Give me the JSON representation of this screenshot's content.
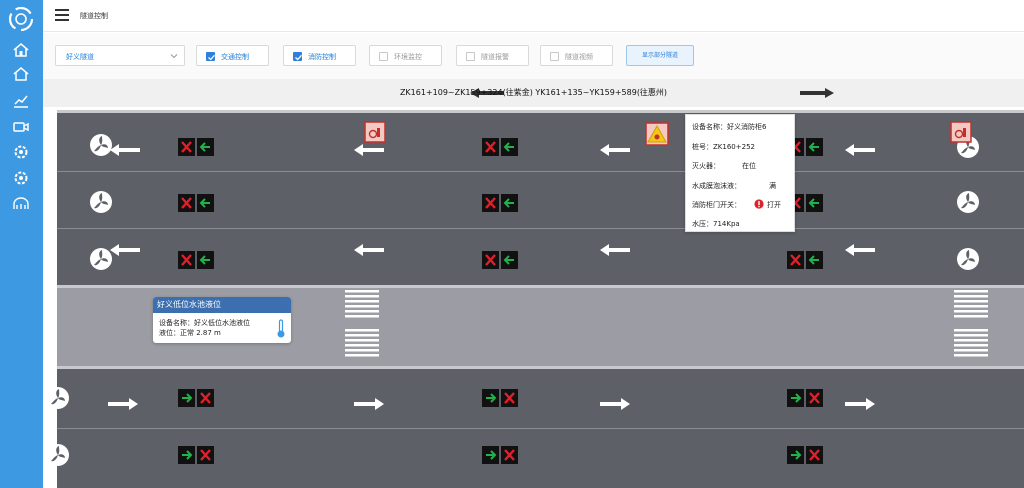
{
  "app": {
    "page_title": "隧道控制"
  },
  "toolbar": {
    "select_value": "好义隧道",
    "checkboxes": [
      {
        "label": "交通控制",
        "checked": true
      },
      {
        "label": "消防控制",
        "checked": true
      },
      {
        "label": "环境监控",
        "checked": false
      },
      {
        "label": "隧道报警",
        "checked": false
      },
      {
        "label": "隧道视频",
        "checked": false
      }
    ],
    "show_button": "显示部分隧道"
  },
  "route": {
    "label": "ZK161+109~ZK159+324(往紫金) YK161+135~YK159+589(往惠州)"
  },
  "device_popup": {
    "name": "设备名称：好义消防柜6",
    "stake": "桩号：ZK160+252",
    "extinguisher_label": "灭火器：",
    "extinguisher_value": "在位",
    "foam_label": "水成膜泡沫液：",
    "foam_value": "满",
    "door_label": "消防柜门开关：",
    "door_value": "打开",
    "pressure": "水压：714Kpa"
  },
  "pool_popup": {
    "title": "好义低位水池液位",
    "name": "设备名称：好义低位水池液位",
    "level": "液位：正常 2.87 m"
  },
  "colors": {
    "sidebar": "#3d9ae2",
    "road": "#5e6068",
    "median": "#9c9da4",
    "signal_red": "#e0202a",
    "signal_green": "#22b14c",
    "popup_header": "#3b6fb0"
  }
}
